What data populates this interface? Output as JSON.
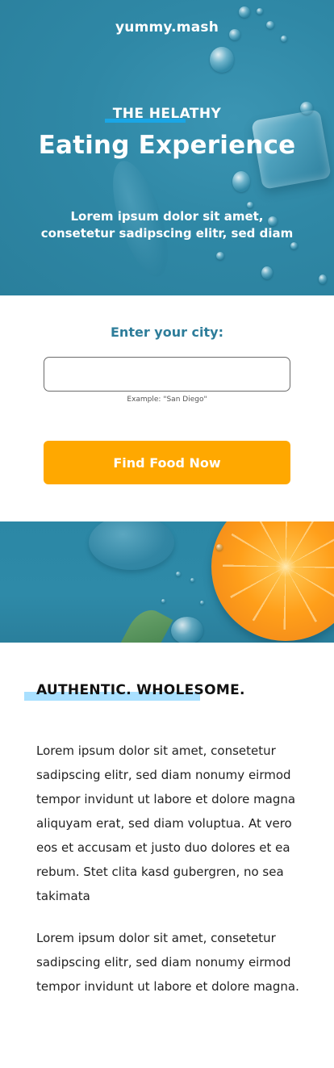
{
  "hero": {
    "brand": "yummy.mash",
    "eyebrow": "THE HELATHY",
    "title": "Eating Experience",
    "subtitle_line1": "Lorem ipsum dolor sit amet,",
    "subtitle_line2": "consetetur sadipscing elitr, sed diam"
  },
  "form": {
    "label": "Enter your city:",
    "input_value": "",
    "hint": "Example: \"San Diego\"",
    "button_label": "Find Food Now"
  },
  "about": {
    "title": "AUTHENTIC. WHOLESOME.",
    "paragraph1": "Lorem ipsum dolor sit amet, consetetur sadipscing elitr, sed diam nonumy eirmod tempor invidunt ut labore et dolore magna aliquyam erat, sed diam voluptua. At vero eos et accusam et justo duo dolores et ea rebum. Stet clita kasd gubergren, no sea takimata",
    "paragraph2": "Lorem ipsum dolor sit amet, consetetur sadipscing elitr, sed diam nonumy eirmod tempor invidunt ut labore et dolore magna."
  },
  "colors": {
    "hero_bg": "#2f88a6",
    "accent_orange": "#ffa800",
    "label_blue": "#2e7d9a",
    "highlight_blue": "#1aa6e6",
    "section_highlight": "#a9e0ff"
  }
}
